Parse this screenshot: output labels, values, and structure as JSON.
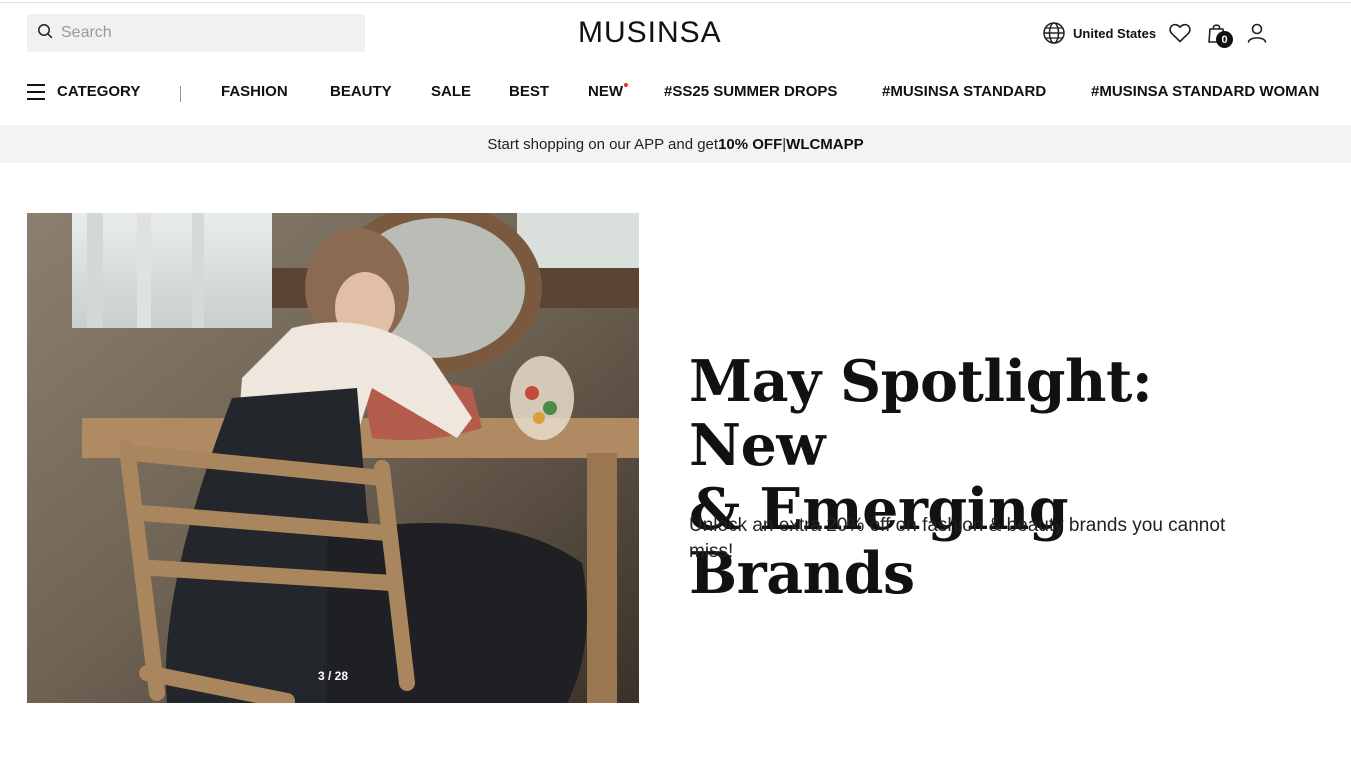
{
  "header": {
    "search_placeholder": "Search",
    "logo": "MUSINSA",
    "country": "United States",
    "cart_count": "0"
  },
  "nav": {
    "category": "CATEGORY",
    "items": [
      "FASHION",
      "BEAUTY",
      "SALE",
      "BEST",
      "NEW",
      "#SS25 SUMMER DROPS",
      "#MUSINSA STANDARD",
      "#MUSINSA STANDARD WOMAN"
    ]
  },
  "promo": {
    "text_before": "Start shopping on our APP and get ",
    "discount": "10% OFF",
    "separator": " | ",
    "code": "WLCMAPP"
  },
  "hero": {
    "title_line1": "May Spotlight: New",
    "title_line2": "& Emerging Brands",
    "subtitle": "Unlock an extra 20% off on fashion & beauty brands you cannot miss!",
    "slide_counter": "3 / 28"
  },
  "icons": {
    "search": "search-icon",
    "globe": "globe-icon",
    "wishlist": "heart-icon",
    "cart": "shopping-bag-icon",
    "account": "user-icon",
    "menu": "hamburger-icon"
  },
  "colors": {
    "text": "#111111",
    "promo_bg": "#f2f3f4",
    "search_bg": "#f1f1f1",
    "new_dot": "#e4322a"
  }
}
